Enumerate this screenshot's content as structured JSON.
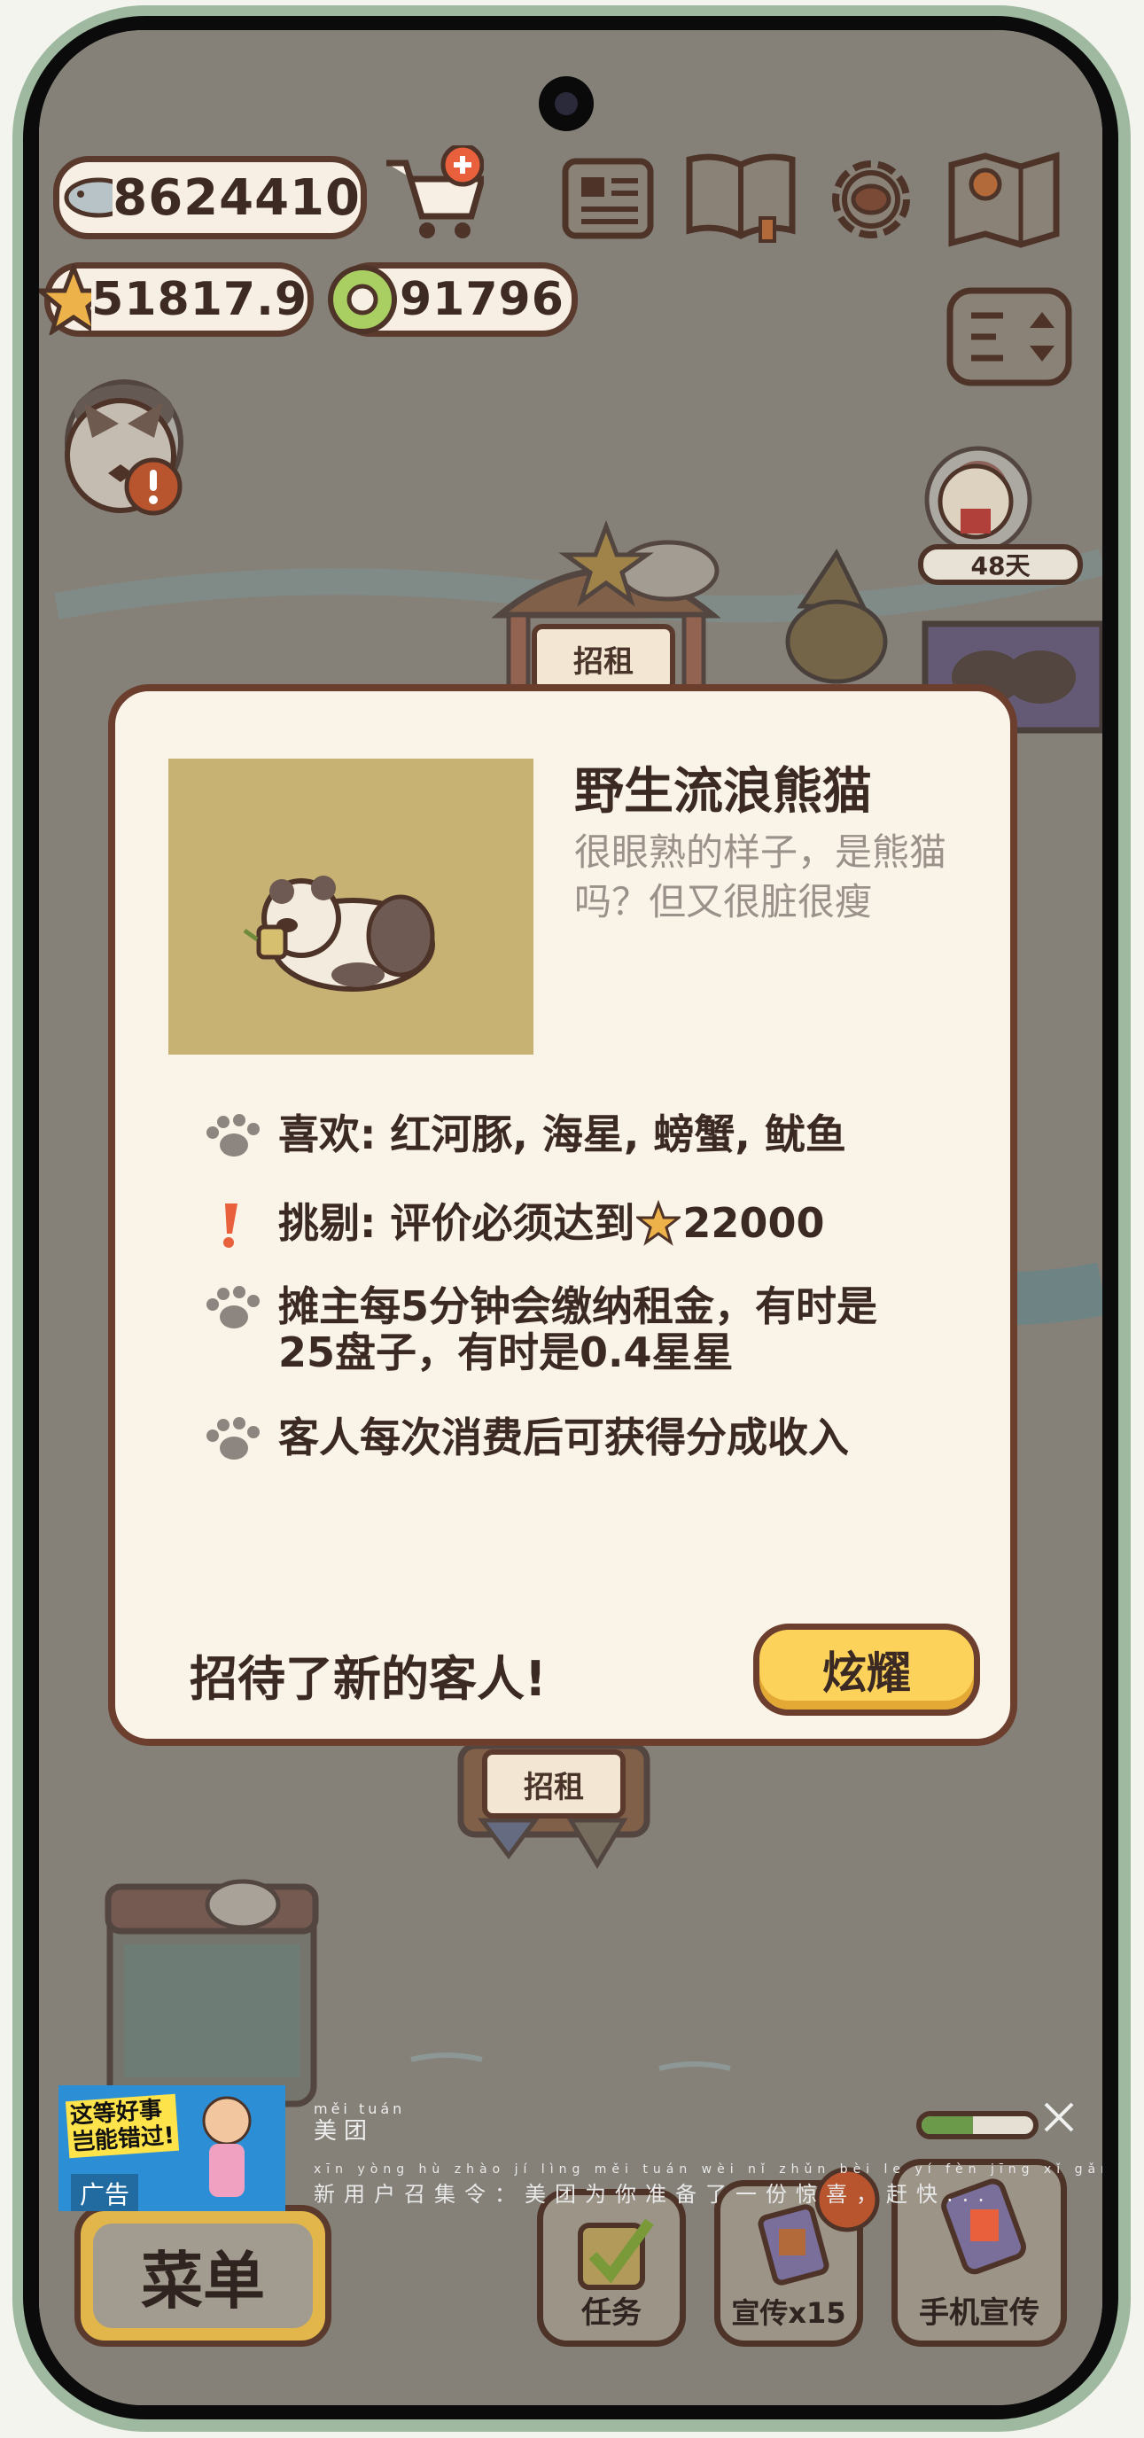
{
  "hud": {
    "fish_count": "8624410",
    "star_rating": "51817.9",
    "coins": "91796",
    "days_label": "48天"
  },
  "map": {
    "stall_sign_top": "招租",
    "stall_sign_bottom": "招租"
  },
  "modal": {
    "title": "野生流浪熊猫",
    "description": "很眼熟的样子，是熊猫吗？但又很脏很瘦",
    "likes": "喜欢: 红河豚, 海星, 螃蟹, 鱿鱼",
    "picky_prefix": "挑剔: 评价必须达到",
    "picky_value": "22000",
    "rent_line1": "摊主每5分钟会缴纳租金，有时是",
    "rent_line2": "25盘子，有时是0.4星星",
    "share_income": "客人每次消费后可获得分成收入",
    "footer_text": "招待了新的客人!",
    "show_off_button": "炫耀"
  },
  "bottom_bar": {
    "menu": "菜单",
    "tasks": "任务",
    "promote": "宣传x15",
    "phone_promote": "手机宣传"
  },
  "ad": {
    "headline_line1": "这等好事",
    "headline_line2": "岂能错过!",
    "ad_label": "广告",
    "brand_pinyin": "měi tuán",
    "brand": "美团",
    "marquee_pinyin": "xīn yòng hù zhào jí lìng  měi tuán wèi nǐ zhǔn bèi le yí fèn jīng xǐ  gǎn kuài",
    "marquee": "新用户召集令：美团为你准备了一份惊喜，赶快..."
  },
  "colors": {
    "frame": "#9fb9a0",
    "modal_bg": "#faf3e8",
    "modal_border": "#6b3e2e",
    "button_yellow": "#fdd25a",
    "text_dark": "#3b2a24",
    "text_gray": "#9a918a",
    "alert_red": "#e8603c"
  },
  "icons": [
    "fish-icon",
    "cart-plus-icon",
    "star-icon",
    "coin-icon",
    "newspaper-icon",
    "book-icon",
    "gear-icon",
    "map-icon",
    "sort-toggle-icon",
    "cat-manager-icon",
    "alert-icon",
    "paw-icon",
    "exclamation-icon",
    "checkbox-icon",
    "close-icon"
  ]
}
